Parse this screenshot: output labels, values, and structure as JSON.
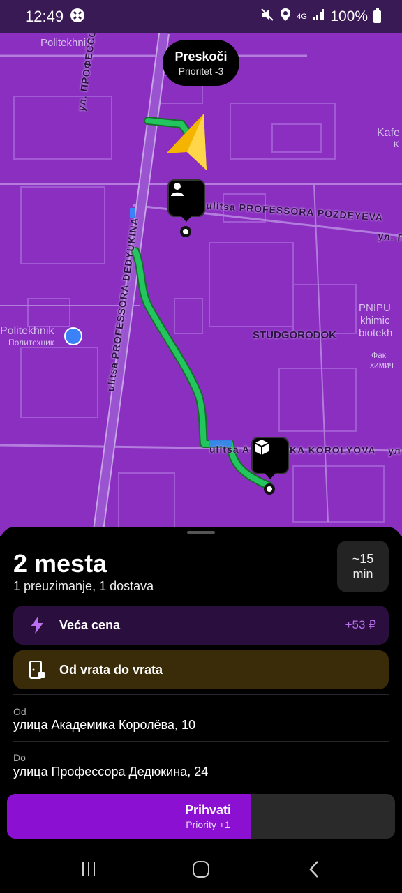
{
  "status_bar": {
    "time": "12:49",
    "battery": "100%",
    "network": "4G",
    "icons": [
      "vpn-icon",
      "mute-icon",
      "location-icon",
      "network-4g-icon",
      "signal-icon",
      "battery-icon"
    ]
  },
  "map": {
    "place_labels": {
      "politekhnik_top": "Politekhnik",
      "politekhnik_station": "Politekhnik",
      "politekhnik_station_ru": "Политехник",
      "studgorodok": "STUDGORODOK",
      "kafe": "Kafe",
      "kafe_sub": "K",
      "pnipu": "PNIPU",
      "pnipu_2": "khimic",
      "pnipu_3": "biotekh",
      "pnipu_4": "Фак",
      "pnipu_5": "химич"
    },
    "street_labels": {
      "dedyukina_ru": "ул. ПРОФЕССОРА ДЕДЮКИ",
      "dedyukina_lat": "ulitsa PROFESSORA DEDYUKINA",
      "pozdeyeva": "ulitsa PROFESSORA POZDEYEVA",
      "pozdeyeva_ru": "ул. П",
      "korolyova_left": "ulitsa A",
      "korolyova_right": "KA KOROLYOVA",
      "korolyova_far": "ул"
    },
    "skip_bubble": {
      "title": "Preskoči",
      "subtitle": "Prioritet -3"
    },
    "accent_route_color": "#22c55e",
    "map_color": "#8a2fc0"
  },
  "sheet": {
    "title": "2 mesta",
    "subtitle": "1 preuzimanje, 1 dostava",
    "eta": {
      "value": "~15",
      "unit": "min"
    },
    "price_card": {
      "label": "Veća cena",
      "value": "+53 ₽",
      "icon": "lightning-icon"
    },
    "door_card": {
      "label": "Od vrata do vrata",
      "icon": "door-icon"
    },
    "from": {
      "label": "Od",
      "address": "улица Академика Королёва, 10"
    },
    "to": {
      "label": "Do",
      "address": "улица Профессора Дедюкина, 24"
    }
  },
  "accept": {
    "title": "Prihvati",
    "subtitle": "Priority +1",
    "progress": 0.63
  },
  "navbar": {
    "icons": [
      "recent-apps-icon",
      "home-icon",
      "back-icon"
    ]
  }
}
